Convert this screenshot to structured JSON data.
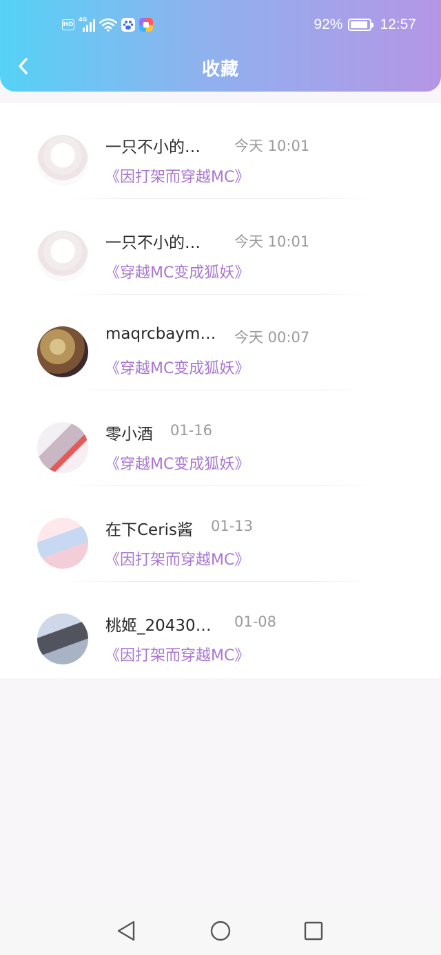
{
  "status_bar": {
    "battery_percent": "92%",
    "battery_level": 0.92,
    "time": "12:57",
    "network": "4G",
    "hd_label": "HD",
    "icons": [
      "hd-icon",
      "signal-icon",
      "wifi-icon",
      "baidu-app-icon",
      "color-app-icon",
      "battery-icon"
    ]
  },
  "header": {
    "title": "收藏",
    "back_icon": "chevron-left-icon",
    "gradient": [
      "#55d2f6",
      "#b596e6"
    ]
  },
  "favorites": [
    {
      "name": "一只不小的…",
      "time": "今天 10:01",
      "book": "《因打架而穿越MC》"
    },
    {
      "name": "一只不小的…",
      "time": "今天 10:01",
      "book": "《穿越MC变成狐妖》"
    },
    {
      "name": "maqrcbaym…",
      "time": "今天 00:07",
      "book": "《穿越MC变成狐妖》"
    },
    {
      "name": "零小酒",
      "time": "01-16",
      "book": "《穿越MC变成狐妖》"
    },
    {
      "name": "在下Ceris酱",
      "time": "01-13",
      "book": "《因打架而穿越MC》"
    },
    {
      "name": "桃姬_20430…",
      "time": "01-08",
      "book": "《因打架而穿越MC》"
    }
  ],
  "colors": {
    "book_title": "#a877d0",
    "name": "#2a2a2a",
    "time": "#9a9a9a"
  },
  "system_nav": {
    "icons": [
      "back-triangle-icon",
      "home-circle-icon",
      "recents-square-icon"
    ]
  }
}
